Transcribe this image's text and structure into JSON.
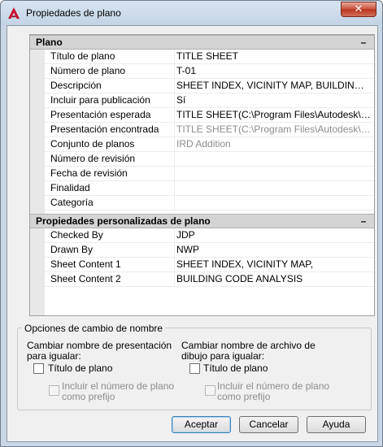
{
  "window": {
    "title": "Propiedades de plano",
    "close_glyph": "✕"
  },
  "sections": {
    "plano": {
      "label": "Plano",
      "toggle": "–"
    },
    "custom": {
      "label": "Propiedades personalizadas de plano",
      "toggle": "–"
    }
  },
  "plano_rows": [
    {
      "name": "Título de plano",
      "value": "TITLE SHEET"
    },
    {
      "name": "Número de plano",
      "value": "T-01"
    },
    {
      "name": "Descripción",
      "value": "SHEET INDEX, VICINITY MAP, BUILDING CODE ANALYSIS"
    },
    {
      "name": "Incluir para publicación",
      "value": "Sí"
    },
    {
      "name": "Presentación esperada",
      "value": "TITLE SHEET(C:\\Program Files\\Autodesk\\AutoCAD\\Sample)"
    },
    {
      "name": "Presentación encontrada",
      "value": "TITLE SHEET(C:\\Program Files\\Autodesk\\AutoCAD\\Sample)"
    },
    {
      "name": "Conjunto de planos",
      "value": "IRD Addition"
    },
    {
      "name": "Número de revisión",
      "value": ""
    },
    {
      "name": "Fecha de revisión",
      "value": ""
    },
    {
      "name": "Finalidad",
      "value": ""
    },
    {
      "name": "Categoría",
      "value": ""
    }
  ],
  "custom_rows": [
    {
      "name": "Checked By",
      "value": "JDP"
    },
    {
      "name": "Drawn By",
      "value": "NWP"
    },
    {
      "name": "Sheet Content 1",
      "value": "SHEET INDEX, VICINITY MAP,"
    },
    {
      "name": "Sheet Content 2",
      "value": "BUILDING CODE ANALYSIS"
    }
  ],
  "rename": {
    "group_title": "Opciones de cambio de nombre",
    "left": {
      "label": "Cambiar nombre de presentación para igualar:",
      "title_cb": "Título de plano",
      "prefix_cb": "Incluir el número de plano como prefijo"
    },
    "right": {
      "label": "Cambiar nombre de archivo de dibujo para igualar:",
      "title_cb": "Título de plano",
      "prefix_cb": "Incluir el número de plano como prefijo"
    }
  },
  "buttons": {
    "ok": "Aceptar",
    "cancel": "Cancelar",
    "help": "Ayuda"
  },
  "colors": {
    "title_accent": "#c8102e",
    "selection_border": "#3c7fb1"
  }
}
